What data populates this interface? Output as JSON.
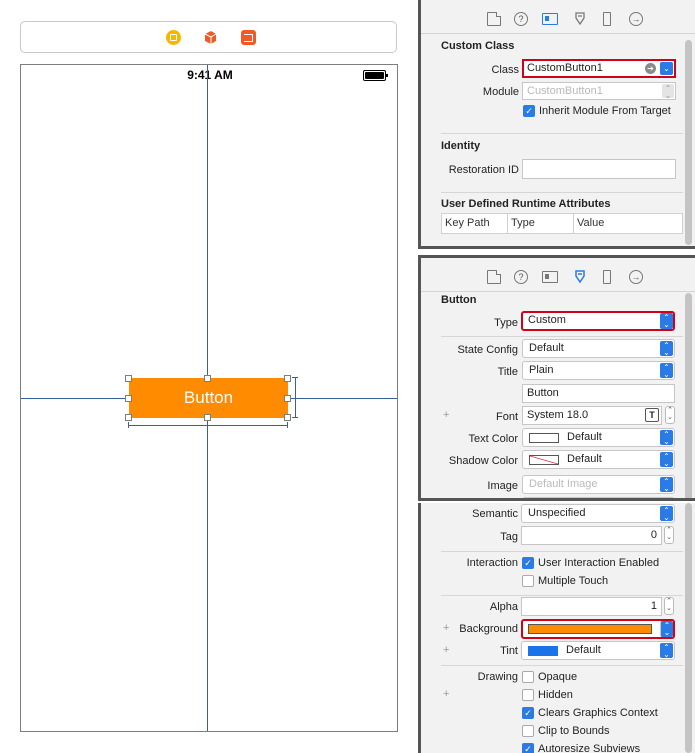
{
  "canvas": {
    "status_time": "9:41 AM",
    "button_title": "Button"
  },
  "identity_inspector": {
    "custom_class_header": "Custom Class",
    "class_label": "Class",
    "class_value": "CustomButton1",
    "module_label": "Module",
    "module_placeholder": "CustomButton1",
    "inherit_label": "Inherit Module From Target",
    "inherit_checked": true,
    "identity_header": "Identity",
    "restoration_label": "Restoration ID",
    "restoration_value": "",
    "runtime_header": "User Defined Runtime Attributes",
    "table_columns": [
      "Key Path",
      "Type",
      "Value"
    ]
  },
  "attributes_inspector": {
    "button_header": "Button",
    "type_label": "Type",
    "type_value": "Custom",
    "state_label": "State Config",
    "state_value": "Default",
    "title_label": "Title",
    "title_value": "Plain",
    "title_text": "Button",
    "font_label": "Font",
    "font_value": "System 18.0",
    "text_color_label": "Text Color",
    "text_color_value": "Default",
    "shadow_label": "Shadow Color",
    "shadow_value": "Default",
    "image_label": "Image",
    "image_placeholder": "Default Image"
  },
  "view_inspector": {
    "semantic_label": "Semantic",
    "semantic_value": "Unspecified",
    "tag_label": "Tag",
    "tag_value": "0",
    "interaction_label": "Interaction",
    "user_interaction": "User Interaction Enabled",
    "multiple_touch": "Multiple Touch",
    "alpha_label": "Alpha",
    "alpha_value": "1",
    "background_label": "Background",
    "background_color": "#ff8c00",
    "tint_label": "Tint",
    "tint_value": "Default",
    "tint_color": "#1a73e8",
    "drawing_label": "Drawing",
    "opaque": "Opaque",
    "hidden": "Hidden",
    "clears_context": "Clears Graphics Context",
    "clip_bounds": "Clip to Bounds",
    "autoresize": "Autoresize Subviews"
  },
  "colors": {
    "accent": "#2b7be6",
    "button_orange": "#ff8c00",
    "highlight_red": "#d0021b",
    "guide_blue": "#35629d"
  }
}
